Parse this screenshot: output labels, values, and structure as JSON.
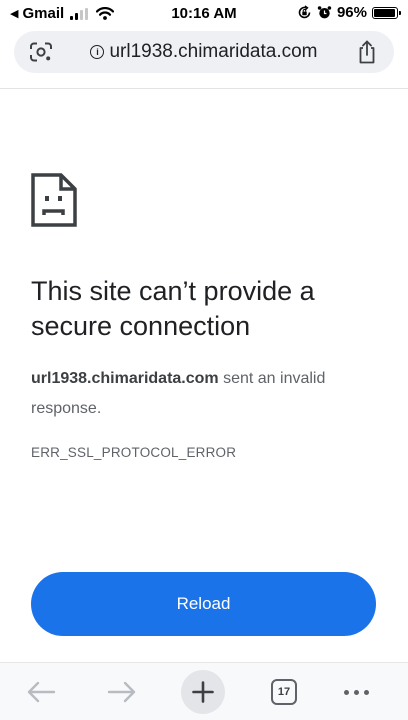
{
  "status_bar": {
    "back_app": "Gmail",
    "time": "10:16 AM",
    "battery_percent": "96%",
    "battery_level": 0.96
  },
  "address_bar": {
    "url": "url1938.chimaridata.com",
    "info_icon_glyph": "i"
  },
  "error": {
    "title": "This site can’t provide a secure connection",
    "host": "url1938.chimaridata.com",
    "message": " sent an invalid response.",
    "code": "ERR_SSL_PROTOCOL_ERROR"
  },
  "reload_label": "Reload",
  "toolbar": {
    "tab_count": "17"
  },
  "colors": {
    "accent": "#1a73e8",
    "url_bar_bg": "#eef0f4",
    "toolbar_bg": "#f8f9fa",
    "text_primary": "#202124",
    "text_secondary": "#5f6368"
  },
  "icons": [
    "back-caret-icon",
    "signal-icon",
    "wifi-icon",
    "orientation-lock-icon",
    "alarm-icon",
    "battery-icon",
    "google-lens-icon",
    "info-icon",
    "share-icon",
    "sad-page-icon",
    "back-arrow-icon",
    "forward-arrow-icon",
    "plus-icon",
    "tab-switcher-icon",
    "more-icon"
  ]
}
